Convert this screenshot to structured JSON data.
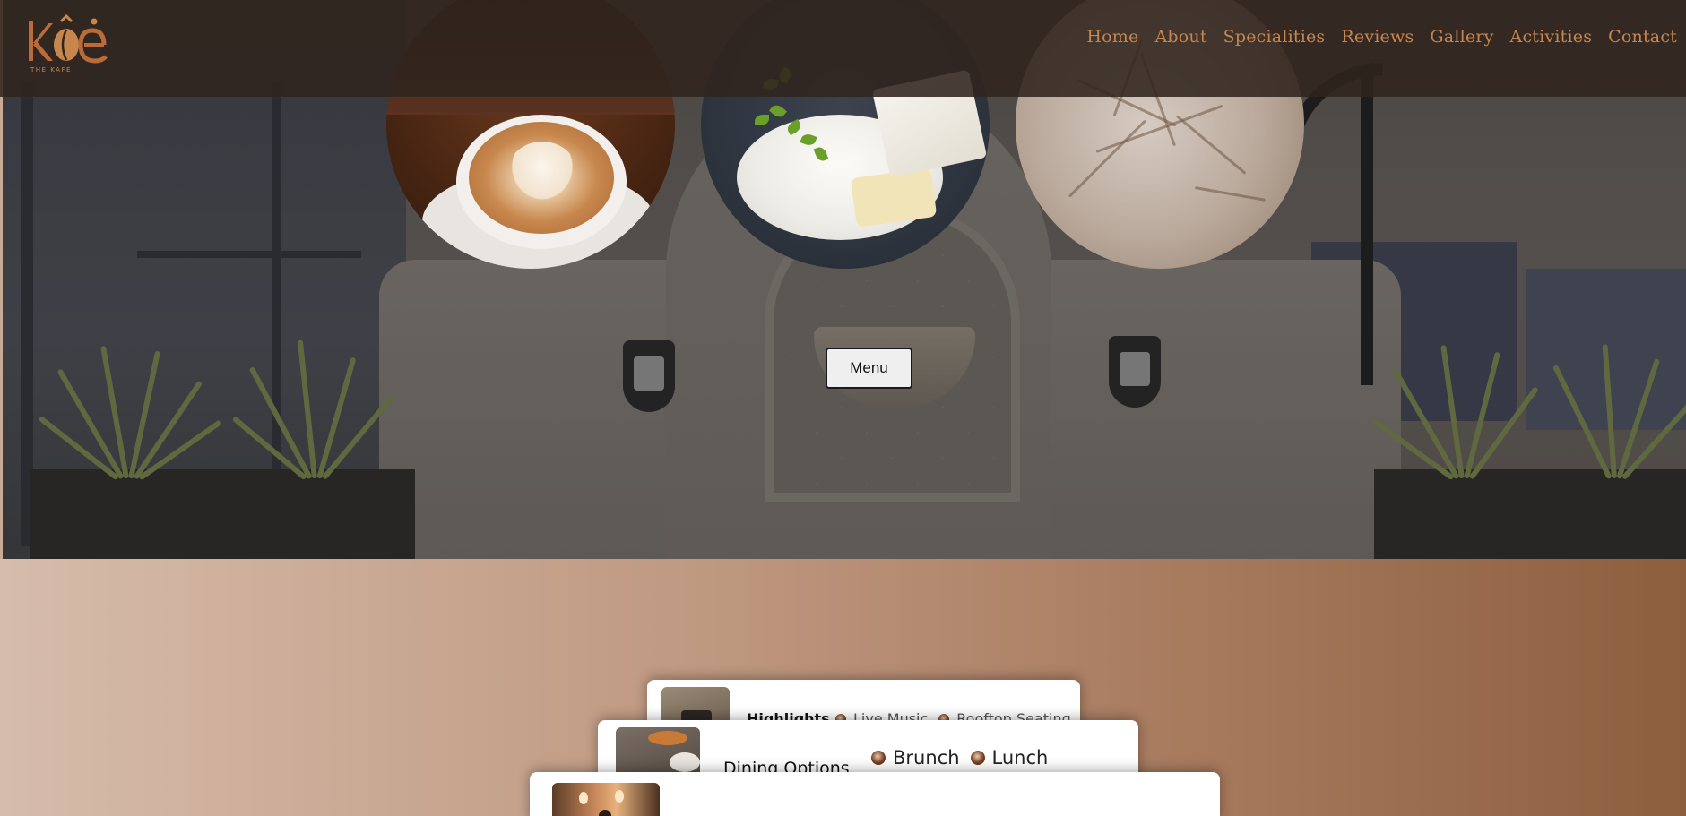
{
  "brand": {
    "logo_mark": "KÔĖ",
    "logo_sub": "THE KAFE"
  },
  "nav": {
    "items": [
      "Home",
      "About",
      "Specialities",
      "Reviews",
      "Gallery",
      "Activities",
      "Contact"
    ]
  },
  "hero": {
    "menu_button_label": "Menu",
    "images": [
      "coffee",
      "cheese",
      "bread"
    ]
  },
  "cards": [
    {
      "title": "Highlights",
      "tags": [
        "Live Music",
        "Rooftop Seating"
      ]
    },
    {
      "title": "Dining Options",
      "tags": [
        "Brunch",
        "Lunch"
      ]
    },
    {
      "title": "",
      "tags": []
    }
  ],
  "colors": {
    "nav_text": "#c8864f",
    "header_bg": "#30241e",
    "gradient_start": "#d6bcab",
    "gradient_end": "#8d5e3e"
  }
}
